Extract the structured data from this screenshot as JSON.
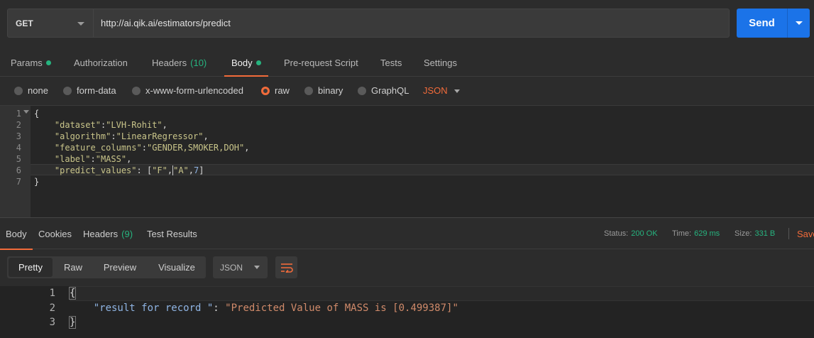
{
  "request": {
    "method": "GET",
    "url": "http://ai.qik.ai/estimators/predict",
    "send_label": "Send"
  },
  "request_tabs": [
    {
      "label": "Params",
      "dot": true
    },
    {
      "label": "Authorization"
    },
    {
      "label": "Headers",
      "count": "(10)"
    },
    {
      "label": "Body",
      "dot": true,
      "active": true
    },
    {
      "label": "Pre-request Script"
    },
    {
      "label": "Tests"
    },
    {
      "label": "Settings"
    }
  ],
  "body_options": {
    "none": "none",
    "form_data": "form-data",
    "urlencoded": "x-www-form-urlencoded",
    "raw": "raw",
    "binary": "binary",
    "graphql": "GraphQL",
    "language": "JSON",
    "selected": "raw"
  },
  "editor": {
    "line_numbers": [
      "1",
      "2",
      "3",
      "4",
      "5",
      "6",
      "7"
    ],
    "lines": {
      "l1": "{",
      "l2_key": "\"dataset\"",
      "l2_val": "\"LVH-Rohit\"",
      "l3_key": "\"algorithm\"",
      "l3_val": "\"LinearRegressor\"",
      "l4_key": "\"feature_columns\"",
      "l4_val": "\"GENDER,SMOKER,DOH\"",
      "l5_key": "\"label\"",
      "l5_val": "\"MASS\"",
      "l6_key": "\"predict_values\"",
      "l6_v1": "\"F\"",
      "l6_v2": "\"A\"",
      "l6_v3": "7",
      "l7": "}"
    }
  },
  "response_tabs": {
    "body": "Body",
    "cookies": "Cookies",
    "headers": "Headers",
    "headers_count": "(9)",
    "test_results": "Test Results"
  },
  "response_meta": {
    "status_label": "Status:",
    "status_value": "200 OK",
    "time_label": "Time:",
    "time_value": "629 ms",
    "size_label": "Size:",
    "size_value": "331 B",
    "save_label": "Save"
  },
  "response_toolbar": {
    "pretty": "Pretty",
    "raw": "Raw",
    "preview": "Preview",
    "visualize": "Visualize",
    "format": "JSON"
  },
  "response_body": {
    "line_numbers": [
      "1",
      "2",
      "3"
    ],
    "open": "{",
    "key": "\"result for record \"",
    "value": "\"Predicted Value of MASS is [0.499387]\"",
    "close": "}"
  },
  "colors": {
    "accent": "#f26b3a",
    "send": "#1b73e8",
    "success": "#26b47f"
  }
}
